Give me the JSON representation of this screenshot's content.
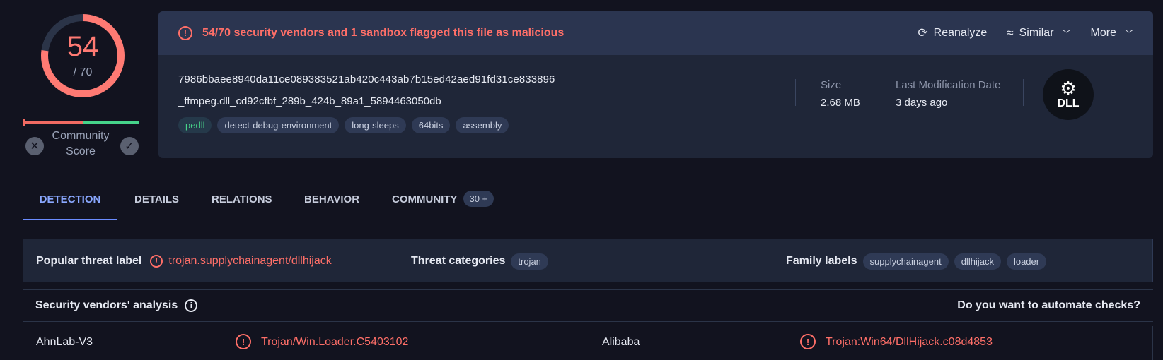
{
  "score": {
    "detections": "54",
    "total": "/ 70",
    "detection_fraction": 0.771,
    "community_label": "Community Score",
    "community_negative_fraction": 0.52
  },
  "alert": {
    "text": "54/70 security vendors and 1 sandbox flagged this file as malicious",
    "reanalyze": "Reanalyze",
    "similar": "Similar",
    "more": "More"
  },
  "file": {
    "hash": "7986bbaee8940da11ce089383521ab420c443ab7b15ed42aed91fd31ce833896",
    "name": "_ffmpeg.dll_cd92cfbf_289b_424b_89a1_5894463050db",
    "tags": [
      "pedll",
      "detect-debug-environment",
      "long-sleeps",
      "64bits",
      "assembly"
    ],
    "size_label": "Size",
    "size_value": "2.68 MB",
    "mod_label": "Last Modification Date",
    "mod_value": "3 days ago",
    "type_badge": "DLL"
  },
  "tabs": [
    {
      "label": "DETECTION",
      "active": true
    },
    {
      "label": "DETAILS"
    },
    {
      "label": "RELATIONS"
    },
    {
      "label": "BEHAVIOR"
    },
    {
      "label": "COMMUNITY",
      "badge": "30 +"
    }
  ],
  "threat": {
    "popular_label": "Popular threat label",
    "popular_value": "trojan.supplychainagent/dllhijack",
    "categories_label": "Threat categories",
    "categories": [
      "trojan"
    ],
    "family_label": "Family labels",
    "families": [
      "supplychainagent",
      "dllhijack",
      "loader"
    ]
  },
  "vendors": {
    "title": "Security vendors' analysis",
    "cta": "Do you want to automate checks?",
    "rows": [
      {
        "vendor1": "AhnLab-V3",
        "result1": "Trojan/Win.Loader.C5403102",
        "vendor2": "Alibaba",
        "result2": "Trojan:Win64/DllHijack.c08d4853"
      }
    ]
  },
  "colors": {
    "malicious": "#ff6f68",
    "accent": "#6b8cff",
    "community_good": "#46d48a"
  }
}
